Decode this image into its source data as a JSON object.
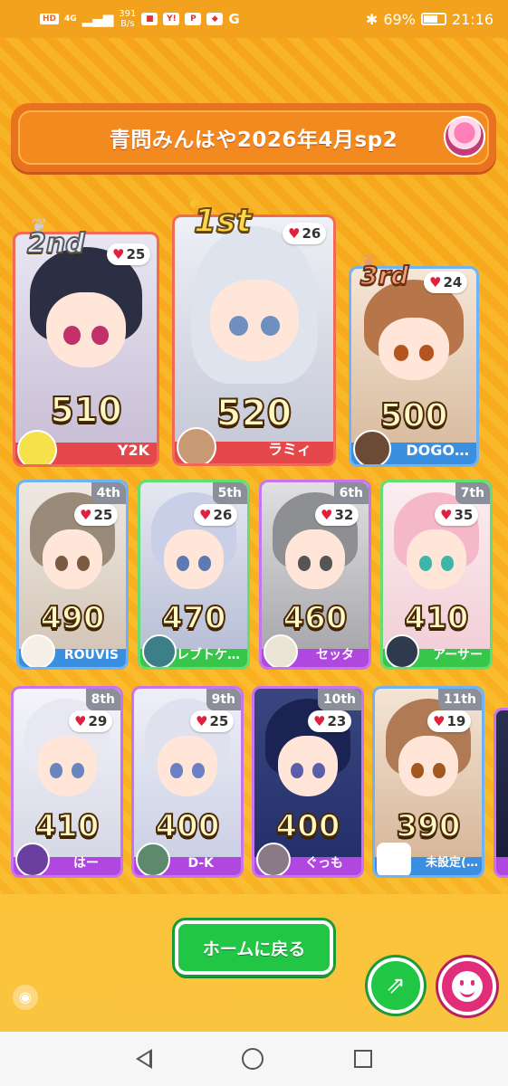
{
  "status_bar": {
    "hd": "HD",
    "network": "4G",
    "speed": "391\nB/s",
    "battery": "69%",
    "time": "21:16",
    "app_g": "G"
  },
  "title": "青問みんはや2026年4月sp2",
  "podium": [
    {
      "rank_label": "2nd",
      "likes": "25",
      "score": "510",
      "owner": "Y2K",
      "color": "red",
      "hair": "#2c2f44"
    },
    {
      "rank_label": "1st",
      "likes": "26",
      "score": "520",
      "owner": "ラミィ",
      "color": "red",
      "hair": "#dfe3ee"
    },
    {
      "rank_label": "3rd",
      "likes": "24",
      "score": "500",
      "owner": "DOGO…",
      "color": "blue",
      "hair": "#b6764a"
    }
  ],
  "row2": [
    {
      "rank_label": "4th",
      "likes": "25",
      "score": "490",
      "owner": "ROUVIS",
      "color": "blue",
      "hair": "#9a8a7a"
    },
    {
      "rank_label": "5th",
      "likes": "26",
      "score": "470",
      "owner": "レブトケ…",
      "color": "green",
      "hair": "#c9cfe6"
    },
    {
      "rank_label": "6th",
      "likes": "32",
      "score": "460",
      "owner": "セッタ",
      "color": "purple",
      "hair": "#8d8f93"
    },
    {
      "rank_label": "7th",
      "likes": "35",
      "score": "410",
      "owner": "アーサー",
      "color": "green",
      "hair": "#f5b8c8"
    }
  ],
  "row3": [
    {
      "rank_label": "8th",
      "likes": "29",
      "score": "410",
      "owner": "はー",
      "color": "purple",
      "hair": "#e8e8f2"
    },
    {
      "rank_label": "9th",
      "likes": "25",
      "score": "400",
      "owner": "D-K",
      "color": "purple",
      "hair": "#dfe1ef"
    },
    {
      "rank_label": "10th",
      "likes": "23",
      "score": "400",
      "owner": "ぐっも",
      "color": "purple",
      "hair": "#23306a"
    },
    {
      "rank_label": "11th",
      "likes": "19",
      "score": "390",
      "owner": "未設定(…",
      "color": "blue",
      "hair": "#b07a55"
    }
  ],
  "buttons": {
    "home": "ホームに戻る"
  },
  "icons": {
    "share": "share-icon",
    "smile": "smile-icon",
    "heart": "heart-icon",
    "wifi": "wifi-icon"
  }
}
